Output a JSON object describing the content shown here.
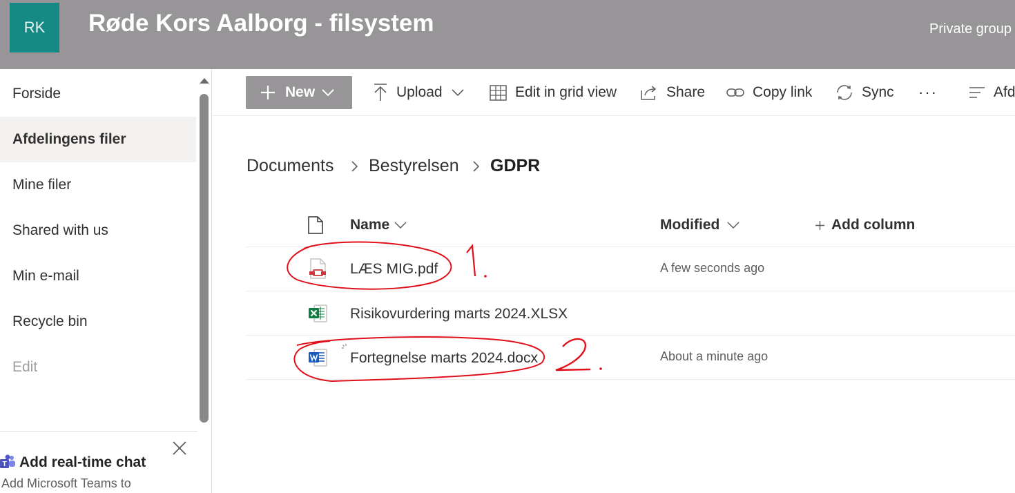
{
  "header": {
    "logo_initials": "RK",
    "site_title": "Røde Kors Aalborg - filsystem",
    "privacy": "Private group"
  },
  "leftnav": {
    "items": [
      {
        "label": "Forside"
      },
      {
        "label": "Afdelingens filer",
        "active": true
      },
      {
        "label": "Mine filer"
      },
      {
        "label": "Shared with us"
      },
      {
        "label": "Min e-mail"
      },
      {
        "label": "Recycle bin"
      },
      {
        "label": "Edit",
        "disabled": true
      }
    ],
    "chat": {
      "title": "Add real-time chat",
      "subtitle": "Add Microsoft Teams to"
    }
  },
  "commandbar": {
    "new": "New",
    "upload": "Upload",
    "edit_grid": "Edit in grid view",
    "share": "Share",
    "copy_link": "Copy link",
    "sync": "Sync",
    "more": "···",
    "view": "Afd"
  },
  "breadcrumb": [
    "Documents",
    "Bestyrelsen",
    "GDPR"
  ],
  "list": {
    "columns": {
      "name": "Name",
      "modified": "Modified",
      "add_column": "Add column"
    },
    "files": [
      {
        "name": "LÆS MIG.pdf",
        "modified": "A few seconds ago",
        "icon": "pdf-icon"
      },
      {
        "name": "Risikovurdering marts 2024.XLSX",
        "modified": "",
        "icon": "excel-icon"
      },
      {
        "name": "Fortegnelse marts 2024.docx",
        "modified": "About a minute ago",
        "icon": "word-icon"
      }
    ]
  },
  "annotations": [
    "1.",
    "2."
  ],
  "colors": {
    "header_bg": "#979598",
    "logo_bg": "#158a85",
    "annotation_red": "#e0101a"
  }
}
